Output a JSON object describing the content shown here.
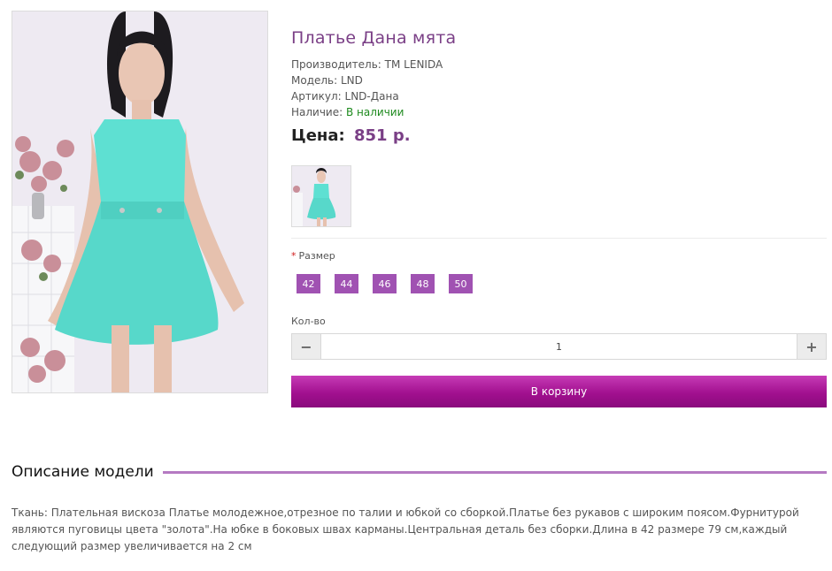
{
  "product": {
    "title": "Платье Дана мята",
    "manufacturer_label": "Производитель:",
    "manufacturer_value": "TM LENIDA",
    "model_label": "Модель:",
    "model_value": "LND",
    "sku_label": "Артикул:",
    "sku_value": "LND-Дана",
    "availability_label": "Наличие:",
    "availability_value": "В наличии",
    "price_label": "Цена:",
    "price_value": "851 р."
  },
  "options": {
    "required_mark": "*",
    "size_label": "Размер",
    "sizes": [
      "42",
      "44",
      "46",
      "48",
      "50"
    ]
  },
  "quantity": {
    "label": "Кол-во",
    "value": "1",
    "minus": "−",
    "plus": "+"
  },
  "cart": {
    "button_label": "В корзину"
  },
  "description": {
    "heading": "Описание модели",
    "text": "Ткань: Плательная вискоза Платье молодежное,отрезное по талии и юбкой со сборкой.Платье без рукавов с широким поясом.Фурнитурой являются пуговицы цвета \"золота\".На юбке в боковых швах карманы.Центральная деталь без сборки.Длина в 42 размере 79 см,каждый следующий размер увеличивается на 2 см"
  },
  "colors": {
    "accent": "#7a3f86",
    "chip": "#a052b2",
    "cart_button": "#a2108f",
    "in_stock": "#1e8a1e",
    "dress": "#5ee0d2"
  }
}
